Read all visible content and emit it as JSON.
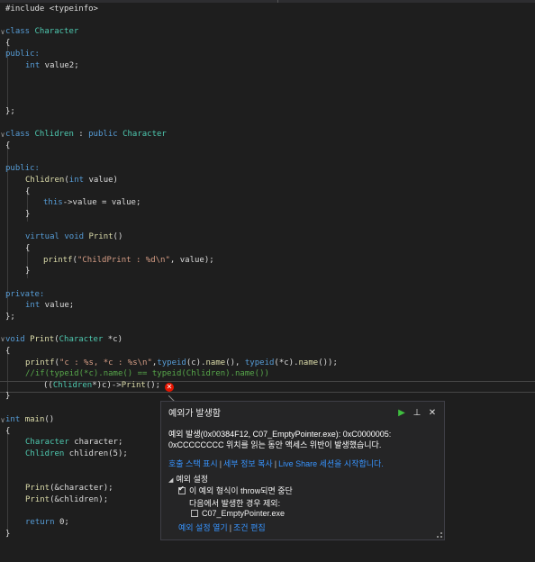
{
  "tab_bar": {},
  "code": {
    "lines": {
      "l0": "#include <typeinfo>",
      "l2a": "class ",
      "l2b": "Character",
      "l3": "{",
      "l4": "public:",
      "l5a": "int",
      "l5b": " value2;",
      "l9": "};",
      "l11a": "class ",
      "l11b": "Chlidren",
      "l11c": " : ",
      "l11d": "public ",
      "l11e": "Character",
      "l12": "{",
      "l14": "public:",
      "l15a": "Chlidren",
      "l15b": "(",
      "l15c": "int",
      "l15d": " value)",
      "l16": "{",
      "l17a": "this",
      "l17b": "->value = value;",
      "l18": "}",
      "l20a": "virtual ",
      "l20b": "void ",
      "l20c": "Print",
      "l20d": "()",
      "l21": "{",
      "l22a": "printf",
      "l22b": "(",
      "l22c": "\"ChildPrint : %d\\n\"",
      "l22d": ", value);",
      "l23": "}",
      "l25": "private:",
      "l26a": "int",
      "l26b": " value;",
      "l27": "};",
      "l29a": "void ",
      "l29b": "Print",
      "l29c": "(",
      "l29d": "Character",
      "l29e": " *c)",
      "l30": "{",
      "l31a": "printf",
      "l31b": "(",
      "l31c": "\"c : %s, *c : %s\\n\"",
      "l31d": ",",
      "l31e": "typeid",
      "l31f": "(c).",
      "l31g": "name",
      "l31h": "(), ",
      "l31i": "typeid",
      "l31j": "(*c).",
      "l31k": "name",
      "l31l": "());",
      "l32": "//if(typeid(*c).name() == typeid(Chlidren).name())",
      "l33a": "((",
      "l33b": "Chlidren",
      "l33c": "*)c)->",
      "l33d": "Print",
      "l33e": "();",
      "l34": "}",
      "l36a": "int ",
      "l36b": "main",
      "l36c": "()",
      "l37": "{",
      "l38a": "Character",
      "l38b": " character;",
      "l39a": "Chlidren",
      "l39b": " chlidren(5);",
      "l42a": "Print",
      "l42b": "(&character);",
      "l43a": "Print",
      "l43b": "(&chlidren);",
      "l45a": "return ",
      "l45b": "0;",
      "l46": "}"
    },
    "fold_marker": "∨"
  },
  "exception_popup": {
    "title": "예외가 발생함",
    "message_line1": "예외 발생(0x00384F12, C07_EmptyPointer.exe): 0xC0000005:",
    "message_line2": "0xCCCCCCCC 위치를 읽는 동안 액세스 위반이 발생했습니다.",
    "link_call_stack": "호출 스택 표시",
    "link_copy_details": "세부 정보 복사",
    "link_live_share": "Live Share 세션을 시작합니다.",
    "settings_header": "예외 설정",
    "break_when_thrown": "이 예외 형식이 throw되면 중단",
    "except_when_from": "다음에서 발생한 경우 제외:",
    "module_name": "C07_EmptyPointer.exe",
    "link_open_settings": "예외 설정 열기",
    "link_edit_conditions": "조건 편집",
    "separator": "|"
  },
  "colors": {
    "editor_bg": "#1e1e1e",
    "keyword": "#569cd6",
    "type": "#4ec9b0",
    "function": "#dcdcaa",
    "string": "#d69d85",
    "comment": "#57a64a",
    "link": "#3794ff",
    "error": "#e51400"
  }
}
